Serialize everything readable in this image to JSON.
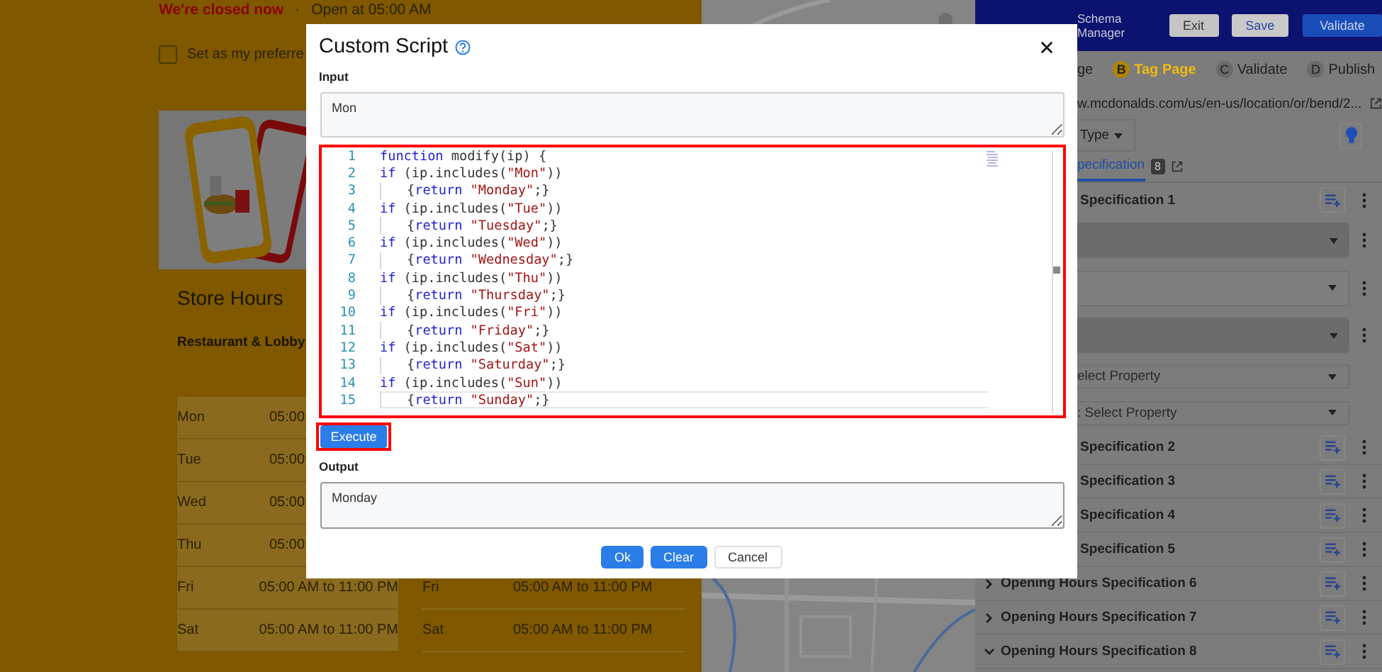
{
  "store_page": {
    "status": {
      "closed": "We're closed now",
      "separator": "·",
      "opening": "Open at 05:00 AM"
    },
    "preferred": {
      "label": "Set as my preferre",
      "checked": false
    },
    "hours_title": "Store Hours",
    "section_title": "Restaurant & Lobby",
    "hours_rows": [
      {
        "day": "Mon",
        "time": "05:00"
      },
      {
        "day": "Tue",
        "time": "05:00"
      },
      {
        "day": "Wed",
        "time": "05:00"
      },
      {
        "day": "Thu",
        "time": "05:00"
      },
      {
        "day": "Fri",
        "time": "05:00 AM to 11:00 PM",
        "day_2": "Fri",
        "time_2": "05:00 AM to 11:00 PM"
      },
      {
        "day": "Sat",
        "time": "05:00 AM to 11:00 PM",
        "day_2": "Sat",
        "time_2": "05:00 AM to 11:00 PM"
      }
    ]
  },
  "schema_manager": {
    "subtitle": "Schema Manager",
    "buttons": [
      {
        "label": "Exit",
        "kind": "plain"
      },
      {
        "label": "Save",
        "kind": "save"
      },
      {
        "label": "Validate",
        "kind": "primary"
      }
    ],
    "steps": [
      {
        "label": "ge",
        "selected": false
      },
      {
        "letter": "B",
        "label": "Tag Page",
        "selected": true
      },
      {
        "letter": "C",
        "label": "Validate",
        "selected": false
      },
      {
        "letter": "D",
        "label": "Publish",
        "selected": false
      }
    ],
    "url": "w.mcdonalds.com/us/en-us/location/or/bend/2...",
    "type_dropdown": "Type",
    "tab": {
      "label": "pecification",
      "count": "8",
      "selected": true
    },
    "first_spec": "Specification 1",
    "fields": [
      {
        "kind": "dark"
      },
      {
        "kind": "light"
      },
      {
        "kind": "dark"
      },
      {
        "kind": "select",
        "placeholder": "elect Property"
      },
      {
        "kind": "select",
        "placeholder": ": Select Property"
      }
    ],
    "specs": [
      {
        "title": "Specification 2"
      },
      {
        "title": "Specification 3"
      },
      {
        "title": "Specification 4"
      },
      {
        "title": "Specification 5"
      },
      {
        "title": "Opening Hours Specification 6",
        "expanded": false
      },
      {
        "title": "Opening Hours Specification 7",
        "expanded": false
      },
      {
        "title": "Opening Hours Specification 8",
        "expanded": true
      }
    ]
  },
  "modal": {
    "title": "Custom Script",
    "input_label": "Input",
    "input_value": "Mon",
    "code_lines": [
      {
        "number": "1",
        "indented": false,
        "current": false,
        "tokens": [
          {
            "kind": "keyword",
            "text": "function"
          },
          {
            "kind": "plain",
            "text": " modify(ip) {"
          }
        ]
      },
      {
        "number": "2",
        "indented": false,
        "current": false,
        "tokens": [
          {
            "kind": "keyword",
            "text": "if"
          },
          {
            "kind": "plain",
            "text": " (ip.includes("
          },
          {
            "kind": "string",
            "text": "\"Mon\""
          },
          {
            "kind": "plain",
            "text": "))"
          }
        ]
      },
      {
        "number": "3",
        "indented": true,
        "current": false,
        "tokens": [
          {
            "kind": "plain",
            "text": "{"
          },
          {
            "kind": "keyword",
            "text": "return"
          },
          {
            "kind": "string",
            "text": " \"Monday\""
          },
          {
            "kind": "plain",
            "text": ";}"
          }
        ]
      },
      {
        "number": "4",
        "indented": false,
        "current": false,
        "tokens": [
          {
            "kind": "keyword",
            "text": "if"
          },
          {
            "kind": "plain",
            "text": " (ip.includes("
          },
          {
            "kind": "string",
            "text": "\"Tue\""
          },
          {
            "kind": "plain",
            "text": "))"
          }
        ]
      },
      {
        "number": "5",
        "indented": true,
        "current": false,
        "tokens": [
          {
            "kind": "plain",
            "text": "{"
          },
          {
            "kind": "keyword",
            "text": "return"
          },
          {
            "kind": "string",
            "text": " \"Tuesday\""
          },
          {
            "kind": "plain",
            "text": ";}"
          }
        ]
      },
      {
        "number": "6",
        "indented": false,
        "current": false,
        "tokens": [
          {
            "kind": "keyword",
            "text": "if"
          },
          {
            "kind": "plain",
            "text": " (ip.includes("
          },
          {
            "kind": "string",
            "text": "\"Wed\""
          },
          {
            "kind": "plain",
            "text": "))"
          }
        ]
      },
      {
        "number": "7",
        "indented": true,
        "current": false,
        "tokens": [
          {
            "kind": "plain",
            "text": "{"
          },
          {
            "kind": "keyword",
            "text": "return"
          },
          {
            "kind": "string",
            "text": " \"Wednesday\""
          },
          {
            "kind": "plain",
            "text": ";}"
          }
        ]
      },
      {
        "number": "8",
        "indented": false,
        "current": false,
        "tokens": [
          {
            "kind": "keyword",
            "text": "if"
          },
          {
            "kind": "plain",
            "text": " (ip.includes("
          },
          {
            "kind": "string",
            "text": "\"Thu\""
          },
          {
            "kind": "plain",
            "text": "))"
          }
        ]
      },
      {
        "number": "9",
        "indented": true,
        "current": false,
        "tokens": [
          {
            "kind": "plain",
            "text": "{"
          },
          {
            "kind": "keyword",
            "text": "return"
          },
          {
            "kind": "string",
            "text": " \"Thursday\""
          },
          {
            "kind": "plain",
            "text": ";}"
          }
        ]
      },
      {
        "number": "10",
        "indented": false,
        "current": false,
        "tokens": [
          {
            "kind": "keyword",
            "text": "if"
          },
          {
            "kind": "plain",
            "text": " (ip.includes("
          },
          {
            "kind": "string",
            "text": "\"Fri\""
          },
          {
            "kind": "plain",
            "text": "))"
          }
        ]
      },
      {
        "number": "11",
        "indented": true,
        "current": false,
        "tokens": [
          {
            "kind": "plain",
            "text": "{"
          },
          {
            "kind": "keyword",
            "text": "return"
          },
          {
            "kind": "string",
            "text": " \"Friday\""
          },
          {
            "kind": "plain",
            "text": ";}"
          }
        ]
      },
      {
        "number": "12",
        "indented": false,
        "current": false,
        "tokens": [
          {
            "kind": "keyword",
            "text": "if"
          },
          {
            "kind": "plain",
            "text": " (ip.includes("
          },
          {
            "kind": "string",
            "text": "\"Sat\""
          },
          {
            "kind": "plain",
            "text": "))"
          }
        ]
      },
      {
        "number": "13",
        "indented": true,
        "current": false,
        "tokens": [
          {
            "kind": "plain",
            "text": "{"
          },
          {
            "kind": "keyword",
            "text": "return"
          },
          {
            "kind": "string",
            "text": " \"Saturday\""
          },
          {
            "kind": "plain",
            "text": ";}"
          }
        ]
      },
      {
        "number": "14",
        "indented": false,
        "current": false,
        "tokens": [
          {
            "kind": "keyword",
            "text": "if"
          },
          {
            "kind": "plain",
            "text": " (ip.includes("
          },
          {
            "kind": "string",
            "text": "\"Sun\""
          },
          {
            "kind": "plain",
            "text": "))"
          }
        ]
      },
      {
        "number": "15",
        "indented": true,
        "current": true,
        "tokens": [
          {
            "kind": "plain",
            "text": "{"
          },
          {
            "kind": "keyword",
            "text": "return"
          },
          {
            "kind": "string",
            "text": " \"Sunday\""
          },
          {
            "kind": "plain",
            "text": ";}"
          }
        ]
      }
    ],
    "execute": "Execute",
    "output_label": "Output",
    "output_value": "Monday",
    "buttons": [
      {
        "label": "Ok",
        "kind": "primary"
      },
      {
        "label": "Clear",
        "kind": "primary"
      },
      {
        "label": "Cancel",
        "kind": "secondary"
      }
    ]
  }
}
